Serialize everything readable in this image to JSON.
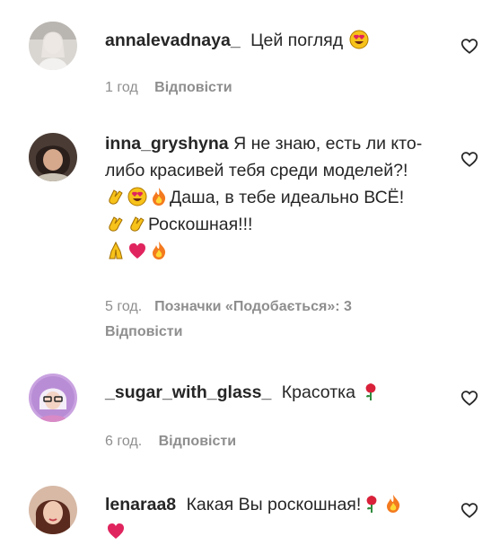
{
  "comments": [
    {
      "username": "annalevadnaya_",
      "text": "Цей погляд",
      "time": "1 год",
      "reply_label": "Відповісти",
      "likes_label": "",
      "avatar_icon": "avatar-photo",
      "emojis": [
        "heart-eyes-emoji"
      ]
    },
    {
      "username": "inna_gryshyna",
      "text_part1": "Я не знаю, есть ли кто-либо красивей тебя среди моделей?!",
      "text_part2": "Даша, в тебе идеально ВСЁ!",
      "text_part3": "Роскошная!!!",
      "time": "5 год.",
      "likes_label": "Позначки «Подобається»: 3",
      "reply_label": "Відповісти",
      "avatar_icon": "avatar-photo"
    },
    {
      "username": "_sugar_with_glass_",
      "text": "Красотка",
      "time": "6 год.",
      "reply_label": "Відповісти",
      "avatar_icon": "avatar-photo"
    },
    {
      "username": "lenaraa8",
      "text": "Какая Вы роскошная!",
      "avatar_icon": "avatar-photo"
    }
  ],
  "icons": {
    "like": "heart-outline-icon"
  },
  "colors": {
    "text": "#262626",
    "meta": "#8e8e8e",
    "heart_red": "#e0245e",
    "emoji_yellow": "#f7c21a"
  }
}
